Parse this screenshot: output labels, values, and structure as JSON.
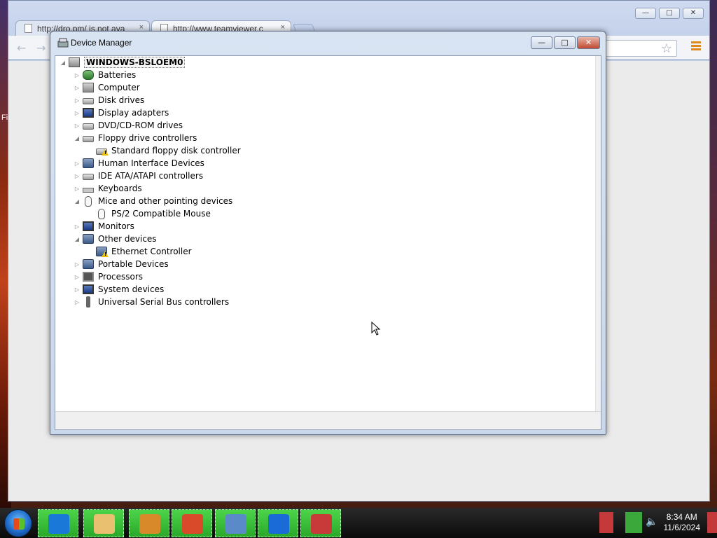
{
  "browser": {
    "tabs": [
      {
        "title": "http://dro.pm/ is not ava"
      },
      {
        "title": "http://www.teamviewer.c"
      }
    ],
    "tab_close_glyph": "×"
  },
  "device_manager": {
    "title": "Device Manager",
    "root": "WINDOWS-BSLOEM0",
    "categories": [
      {
        "label": "Batteries",
        "icon": "battery-icon",
        "expanded": false
      },
      {
        "label": "Computer",
        "icon": "computer-icon",
        "expanded": false
      },
      {
        "label": "Disk drives",
        "icon": "disk-drive-icon",
        "expanded": false
      },
      {
        "label": "Display adapters",
        "icon": "display-adapter-icon",
        "expanded": false
      },
      {
        "label": "DVD/CD-ROM drives",
        "icon": "dvd-drive-icon",
        "expanded": false
      },
      {
        "label": "Floppy drive controllers",
        "icon": "floppy-controller-icon",
        "expanded": true,
        "children": [
          {
            "label": "Standard floppy disk controller",
            "icon": "floppy-controller-warning-icon"
          }
        ]
      },
      {
        "label": "Human Interface Devices",
        "icon": "hid-icon",
        "expanded": false
      },
      {
        "label": "IDE ATA/ATAPI controllers",
        "icon": "ide-controller-icon",
        "expanded": false
      },
      {
        "label": "Keyboards",
        "icon": "keyboard-icon",
        "expanded": false
      },
      {
        "label": "Mice and other pointing devices",
        "icon": "mouse-icon",
        "expanded": true,
        "children": [
          {
            "label": "PS/2 Compatible Mouse",
            "icon": "mouse-icon"
          }
        ]
      },
      {
        "label": "Monitors",
        "icon": "monitor-icon",
        "expanded": false
      },
      {
        "label": "Other devices",
        "icon": "unknown-device-icon",
        "expanded": true,
        "children": [
          {
            "label": "Ethernet Controller",
            "icon": "unknown-device-warning-icon"
          }
        ]
      },
      {
        "label": "Portable Devices",
        "icon": "portable-device-icon",
        "expanded": false
      },
      {
        "label": "Processors",
        "icon": "processor-icon",
        "expanded": false
      },
      {
        "label": "System devices",
        "icon": "system-device-icon",
        "expanded": false
      },
      {
        "label": "Universal Serial Bus controllers",
        "icon": "usb-icon",
        "expanded": false
      }
    ]
  },
  "window_controls": {
    "minimize": "—",
    "maximize": "□",
    "close": "✕"
  },
  "browser_controls": {
    "minimize": "—",
    "maximize": "□",
    "close": "✕"
  },
  "taskbar": {
    "apps": [
      "internet-explorer-icon",
      "file-explorer-icon",
      "media-player-icon",
      "chrome-icon",
      "control-panel-icon",
      "teamviewer-icon",
      "toolbox-icon"
    ],
    "clock_time": "8:34 AM",
    "clock_date": "11/6/2024"
  },
  "desktop": {
    "left_text": "Fi"
  }
}
